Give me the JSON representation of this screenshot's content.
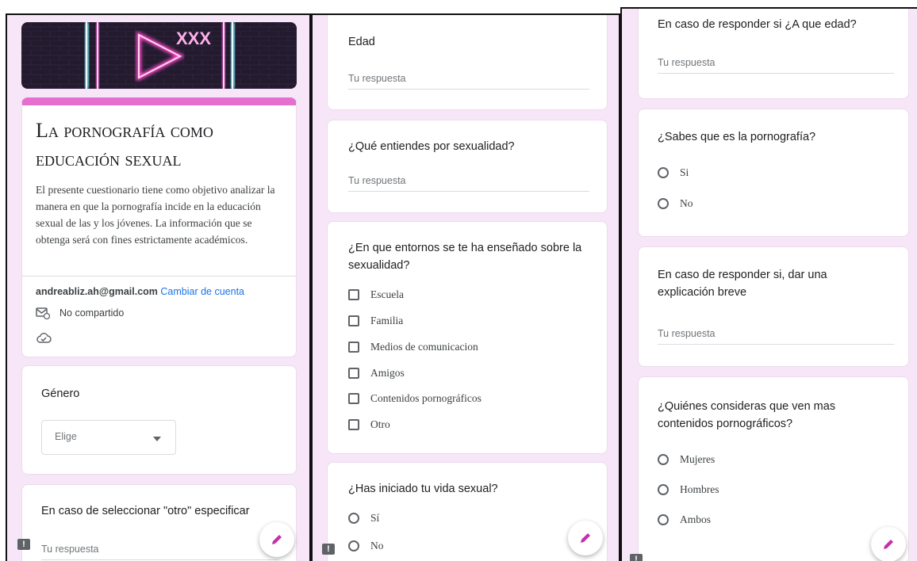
{
  "banner": {
    "neon_text": "XXX"
  },
  "form": {
    "title": "La pornografía como educación sexual",
    "description": "El presente cuestionario tiene como objetivo analizar la manera en que la pornografía incide en la educación sexual de las y los jóvenes. La información que se obtenga será con fines estrictamente académicos.",
    "account_email": "andreabliz.ah@gmail.com",
    "switch_account": "Cambiar de cuenta",
    "not_shared": "No compartido"
  },
  "answer_placeholder": "Tu respuesta",
  "questions": {
    "genero": {
      "title": "Género",
      "dropdown_placeholder": "Elige"
    },
    "otro": {
      "title": "En caso de seleccionar \"otro\" especificar"
    },
    "edad": {
      "title": "Edad"
    },
    "sexualidad": {
      "title": "¿Qué entiendes por sexualidad?"
    },
    "entornos": {
      "title": "¿En que entornos se te ha enseñado sobre la sexualidad?",
      "options": [
        "Escuela",
        "Familia",
        "Medios de comunicacion",
        "Amigos",
        "Contenidos pornográficos",
        "Otro"
      ]
    },
    "vida_sexual": {
      "title": "¿Has iniciado tu vida sexual?",
      "options": [
        "Sí",
        "No"
      ]
    },
    "edad_si": {
      "title": "En caso de responder si ¿A que edad?"
    },
    "sabes_porno": {
      "title": "¿Sabes que es la pornografía?",
      "options": [
        "Si",
        "No"
      ]
    },
    "explicacion": {
      "title": "En caso de responder si, dar una explicación breve"
    },
    "quienes": {
      "title": "¿Quiénes consideras que ven mas contenidos pornográficos?",
      "options": [
        "Mujeres",
        "Hombres",
        "Ambos"
      ]
    }
  },
  "colors": {
    "accent": "#e56fcf",
    "link": "#1a73e8",
    "background": "#f7e6f7"
  },
  "icons": {
    "edit": "pencil-icon",
    "report": "report-icon",
    "cloud": "cloud-check-icon",
    "mail": "mail-not-shared-icon"
  }
}
